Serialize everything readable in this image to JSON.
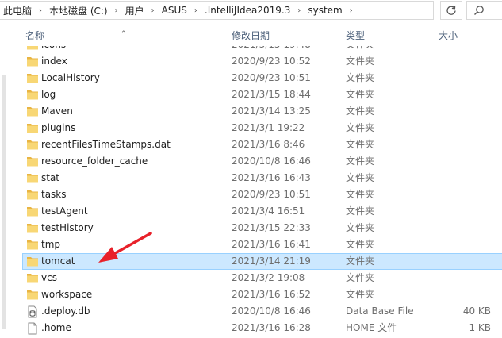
{
  "breadcrumb": [
    {
      "label": "此电脑"
    },
    {
      "label": "本地磁盘 (C:)"
    },
    {
      "label": "用户"
    },
    {
      "label": "ASUS"
    },
    {
      "label": ".IntelliJIdea2019.3"
    },
    {
      "label": "system"
    }
  ],
  "columns": {
    "name": "名称",
    "date": "修改日期",
    "type": "类型",
    "size": "大小"
  },
  "rows": [
    {
      "name": "icons",
      "date": "2021/3/15 19:48",
      "type": "文件夹",
      "size": "",
      "icon": "folder-icon",
      "selected": false
    },
    {
      "name": "index",
      "date": "2020/9/23 10:52",
      "type": "文件夹",
      "size": "",
      "icon": "folder-icon",
      "selected": false
    },
    {
      "name": "LocalHistory",
      "date": "2020/9/23 10:51",
      "type": "文件夹",
      "size": "",
      "icon": "folder-icon",
      "selected": false
    },
    {
      "name": "log",
      "date": "2021/3/15 18:44",
      "type": "文件夹",
      "size": "",
      "icon": "folder-icon",
      "selected": false
    },
    {
      "name": "Maven",
      "date": "2021/3/14 13:25",
      "type": "文件夹",
      "size": "",
      "icon": "folder-icon",
      "selected": false
    },
    {
      "name": "plugins",
      "date": "2021/3/1 19:22",
      "type": "文件夹",
      "size": "",
      "icon": "folder-icon",
      "selected": false
    },
    {
      "name": "recentFilesTimeStamps.dat",
      "date": "2021/3/16 8:46",
      "type": "文件夹",
      "size": "",
      "icon": "folder-icon",
      "selected": false
    },
    {
      "name": "resource_folder_cache",
      "date": "2020/10/8 16:46",
      "type": "文件夹",
      "size": "",
      "icon": "folder-icon",
      "selected": false
    },
    {
      "name": "stat",
      "date": "2021/3/16 16:43",
      "type": "文件夹",
      "size": "",
      "icon": "folder-icon",
      "selected": false
    },
    {
      "name": "tasks",
      "date": "2020/9/23 10:51",
      "type": "文件夹",
      "size": "",
      "icon": "folder-icon",
      "selected": false
    },
    {
      "name": "testAgent",
      "date": "2021/3/4 16:51",
      "type": "文件夹",
      "size": "",
      "icon": "folder-icon",
      "selected": false
    },
    {
      "name": "testHistory",
      "date": "2021/3/15 22:33",
      "type": "文件夹",
      "size": "",
      "icon": "folder-icon",
      "selected": false
    },
    {
      "name": "tmp",
      "date": "2021/3/16 16:41",
      "type": "文件夹",
      "size": "",
      "icon": "folder-icon",
      "selected": false
    },
    {
      "name": "tomcat",
      "date": "2021/3/14 21:19",
      "type": "文件夹",
      "size": "",
      "icon": "folder-icon",
      "selected": true
    },
    {
      "name": "vcs",
      "date": "2021/3/2 19:08",
      "type": "文件夹",
      "size": "",
      "icon": "folder-icon",
      "selected": false
    },
    {
      "name": "workspace",
      "date": "2021/3/16 16:52",
      "type": "文件夹",
      "size": "",
      "icon": "folder-icon",
      "selected": false
    },
    {
      "name": ".deploy.db",
      "date": "2020/10/8 16:46",
      "type": "Data Base File",
      "size": "40 KB",
      "icon": "db-file-icon",
      "selected": false
    },
    {
      "name": ".home",
      "date": "2021/3/16 16:28",
      "type": "HOME 文件",
      "size": "1 KB",
      "icon": "file-icon",
      "selected": false
    }
  ],
  "colors": {
    "selection_bg": "#cce8ff",
    "selection_border": "#99d1ff",
    "folder": "#f8d775",
    "annotation_arrow": "#e8212a"
  }
}
